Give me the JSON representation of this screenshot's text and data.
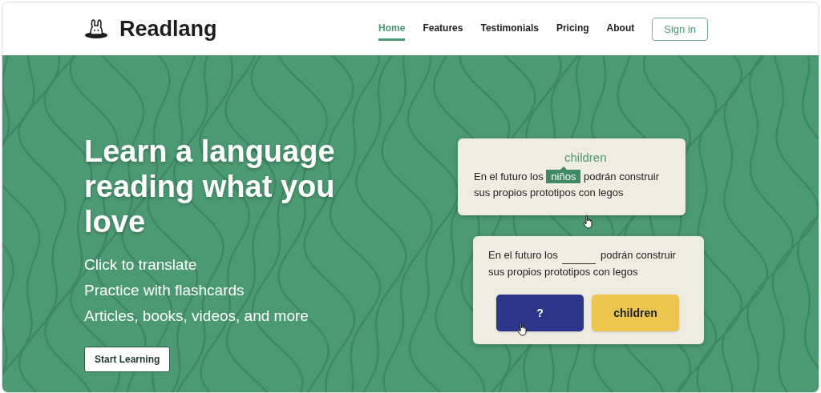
{
  "brand": {
    "name": "Readlang"
  },
  "nav": [
    {
      "label": "Home",
      "selected": true
    },
    {
      "label": "Features",
      "selected": false
    },
    {
      "label": "Testimonials",
      "selected": false
    },
    {
      "label": "Pricing",
      "selected": false
    },
    {
      "label": "About",
      "selected": false
    }
  ],
  "sign_in": "Sign in",
  "hero": {
    "headline": "Learn a language reading what you love",
    "features": [
      "Click to translate",
      "Practice with flashcards",
      "Articles, books, videos, and more"
    ],
    "cta": "Start Learning"
  },
  "translate_card": {
    "translation": "children",
    "before": "En el futuro los",
    "word": "niños",
    "after": "podrán construir sus propios prototipos con legos"
  },
  "quiz_card": {
    "before": "En el futuro los",
    "after": "podrán construir sus propios prototipos con legos",
    "options": [
      {
        "label": "?",
        "kind": "hidden",
        "color": "#2b3688"
      },
      {
        "label": "children",
        "kind": "answer",
        "color": "#ecc64f"
      }
    ]
  }
}
